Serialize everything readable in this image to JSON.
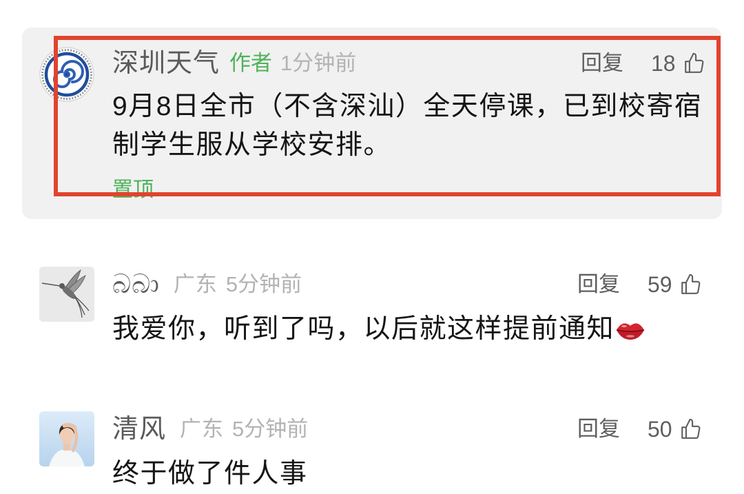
{
  "comments": [
    {
      "avatar": "shenzhen-weather-emblem",
      "author": "深圳天气",
      "badge": "作者",
      "time": "1分钟前",
      "reply_label": "回复",
      "likes": "18",
      "text": "9月8日全市（不含深汕）全天停课，已到校寄宿制学生服从学校安排。",
      "pinned_label": "置顶"
    },
    {
      "avatar": "hummingbird-avatar",
      "author": "බබා",
      "location": "广东",
      "time": "5分钟前",
      "reply_label": "回复",
      "likes": "59",
      "text": "我爱你，听到了吗，以后就这样提前通知",
      "emoji": "lips-emoji-icon"
    },
    {
      "avatar": "portrait-avatar",
      "author": "清风",
      "location": "广东",
      "time": "5分钟前",
      "reply_label": "回复",
      "likes": "50",
      "text": "终于做了件人事"
    }
  ],
  "colors": {
    "accent_green": "#4fb25a",
    "annotation_red": "#e2432d",
    "pinned_card_bg": "#f1f1f1"
  }
}
